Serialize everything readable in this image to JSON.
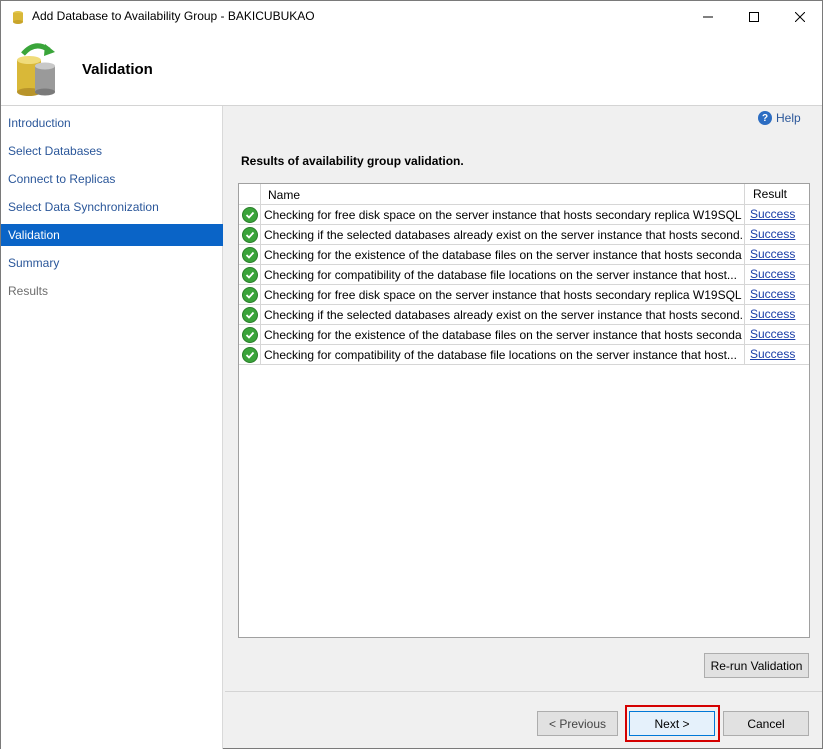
{
  "window": {
    "title": "Add Database to Availability Group - BAKICUBUKAO"
  },
  "header": {
    "title": "Validation"
  },
  "nav": {
    "items": [
      {
        "label": "Introduction",
        "state": "normal"
      },
      {
        "label": "Select Databases",
        "state": "normal"
      },
      {
        "label": "Connect to Replicas",
        "state": "normal"
      },
      {
        "label": "Select Data Synchronization",
        "state": "normal"
      },
      {
        "label": "Validation",
        "state": "active"
      },
      {
        "label": "Summary",
        "state": "normal"
      },
      {
        "label": "Results",
        "state": "disabled"
      }
    ]
  },
  "help": {
    "label": "Help",
    "icon": "help-icon"
  },
  "main": {
    "results_label": "Results of availability group validation.",
    "grid": {
      "columns": [
        "Name",
        "Result"
      ],
      "rows": [
        {
          "name": "Checking for free disk space on the server instance that hosts secondary replica W19SQL...",
          "result": "Success"
        },
        {
          "name": "Checking if the selected databases already exist on the server instance that hosts second...",
          "result": "Success"
        },
        {
          "name": "Checking for the existence of the database files on the server instance that hosts seconda...",
          "result": "Success"
        },
        {
          "name": "Checking for compatibility of the database file locations on the server instance that host...",
          "result": "Success"
        },
        {
          "name": "Checking for free disk space on the server instance that hosts secondary replica W19SQL...",
          "result": "Success"
        },
        {
          "name": "Checking if the selected databases already exist on the server instance that hosts second...",
          "result": "Success"
        },
        {
          "name": "Checking for the existence of the database files on the server instance that hosts seconda...",
          "result": "Success"
        },
        {
          "name": "Checking for compatibility of the database file locations on the server instance that host...",
          "result": "Success"
        }
      ]
    }
  },
  "buttons": {
    "rerun": "Re-run Validation",
    "previous": "< Previous",
    "next": "Next >",
    "cancel": "Cancel"
  },
  "colors": {
    "nav_active_bg": "#0a64c7",
    "link": "#2b579a",
    "success_icon": "#3aa33a",
    "highlight": "#d40000"
  }
}
